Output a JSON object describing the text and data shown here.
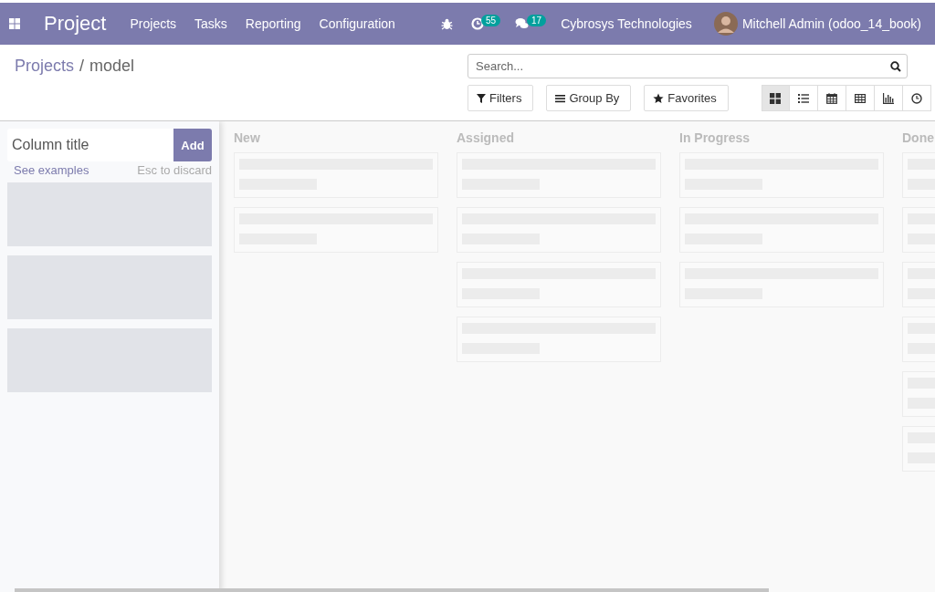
{
  "navbar": {
    "app_name": "Project",
    "menu": [
      "Projects",
      "Tasks",
      "Reporting",
      "Configuration"
    ],
    "activity_count": "55",
    "message_count": "17",
    "company": "Cybrosys Technologies",
    "user": "Mitchell Admin (odoo_14_book)"
  },
  "breadcrumb": {
    "items": [
      "Projects",
      "model"
    ],
    "separator": "/"
  },
  "search": {
    "placeholder": "Search..."
  },
  "filter_buttons": [
    {
      "kind": "filter",
      "label": "Filters"
    },
    {
      "kind": "group",
      "label": "Group By"
    },
    {
      "kind": "favorite",
      "label": "Favorites"
    }
  ],
  "views": [
    {
      "kind": "kanban",
      "selected": true
    },
    {
      "kind": "list",
      "selected": false
    },
    {
      "kind": "calendar",
      "selected": false
    },
    {
      "kind": "pivot",
      "selected": false
    },
    {
      "kind": "graph",
      "selected": false
    },
    {
      "kind": "activity",
      "selected": false
    }
  ],
  "quick_create": {
    "placeholder": "Column title",
    "add_label": "Add",
    "examples_link": "See examples",
    "discard_hint": "Esc to discard",
    "ghost_columns": [
      {
        "kind": "ghost"
      },
      {
        "kind": "ghost"
      },
      {
        "kind": "ghost"
      }
    ]
  },
  "columns": [
    {
      "title": "New",
      "cards": [
        {
          "kind": "placeholder"
        },
        {
          "kind": "placeholder"
        }
      ]
    },
    {
      "title": "Assigned",
      "cards": [
        {
          "kind": "placeholder"
        },
        {
          "kind": "placeholder"
        },
        {
          "kind": "placeholder"
        },
        {
          "kind": "placeholder"
        }
      ]
    },
    {
      "title": "In Progress",
      "cards": [
        {
          "kind": "placeholder"
        },
        {
          "kind": "placeholder"
        },
        {
          "kind": "placeholder"
        }
      ]
    },
    {
      "title": "Done",
      "cards": [
        {
          "kind": "placeholder"
        },
        {
          "kind": "placeholder"
        },
        {
          "kind": "placeholder"
        },
        {
          "kind": "placeholder"
        },
        {
          "kind": "placeholder"
        },
        {
          "kind": "placeholder"
        }
      ]
    }
  ]
}
